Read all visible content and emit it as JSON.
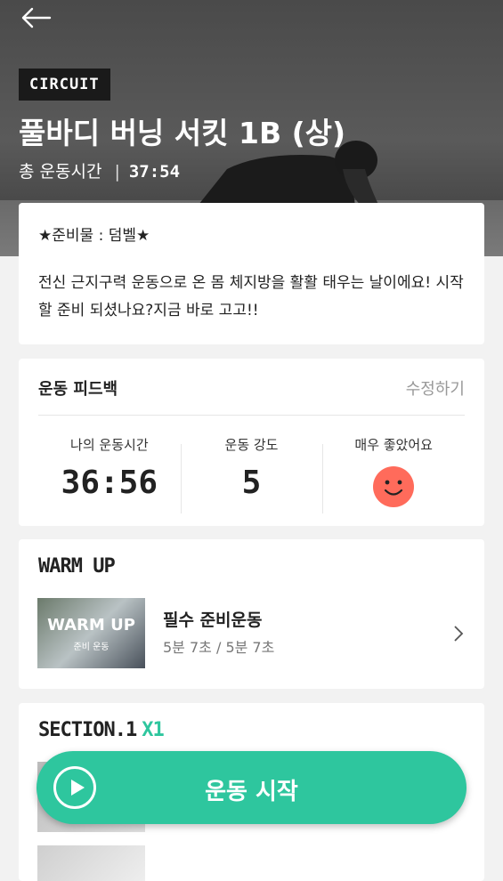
{
  "header": {
    "tag": "CIRCUIT",
    "title": "풀바디 버닝 서킷 1B (상)",
    "total_label": "총 운동시간",
    "separator": "|",
    "total_time": "37:54"
  },
  "description": {
    "equipment": "★준비물 : 덤벨★",
    "text": "전신 근지구력 운동으로 온 몸 체지방을 활활 태우는 날이에요! 시작 할 준비 되셨나요?지금 바로 고고!!"
  },
  "feedback": {
    "label": "운동 피드백",
    "edit_label": "수정하기",
    "stats": [
      {
        "label": "나의 운동시간",
        "value": "36:56"
      },
      {
        "label": "운동 강도",
        "value": "5"
      },
      {
        "label": "매우 좋았어요",
        "icon": "smiley-icon",
        "color": "#ff6b5b"
      }
    ]
  },
  "warmup": {
    "heading": "WARM UP",
    "thumb_title": "WARM UP",
    "thumb_sub": "준비 운동",
    "item_title": "필수 준비운동",
    "item_sub": "5분 7초 / 5분 7초"
  },
  "section1": {
    "heading": "SECTION.1",
    "multiplier": "X1"
  },
  "start_button": {
    "label": "운동 시작",
    "color": "#2ec69e"
  }
}
